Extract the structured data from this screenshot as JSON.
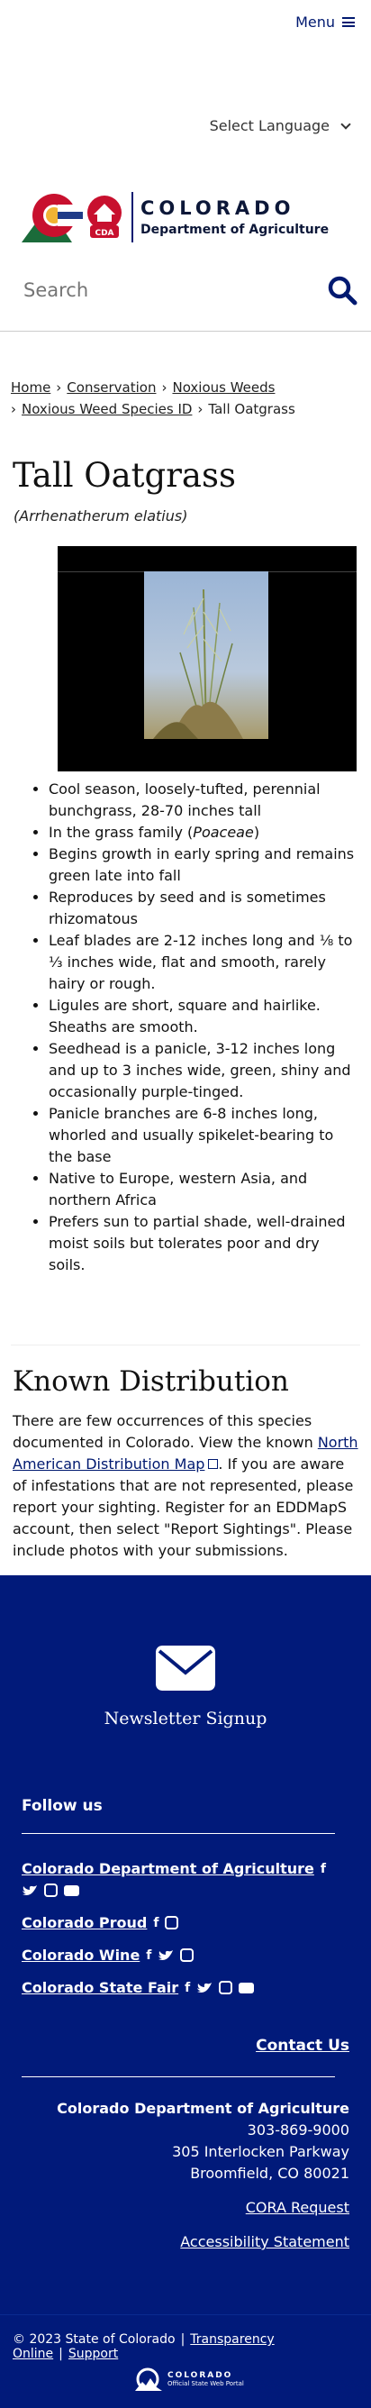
{
  "header": {
    "menu_label": "Menu",
    "language_label": "Select Language",
    "logo": {
      "cda_badge": "CDA",
      "title": "COLORADO",
      "subtitle": "Department of Agriculture"
    },
    "search_placeholder": "Search"
  },
  "breadcrumb": [
    "Home",
    "Conservation",
    "Noxious Weeds",
    "Noxious Weed Species ID",
    "Tall Oatgrass"
  ],
  "page": {
    "title": "Tall Oatgrass",
    "scientific_name": "(Arrhenatherum elatius)",
    "facts": [
      "Cool season, loosely-tufted, perennial bunchgrass, 28-70 inches tall",
      [
        "In the grass family (",
        "Poaceae",
        ")"
      ],
      "Begins growth in early spring and remains green late into fall",
      "Reproduces by seed and is sometimes rhizomatous",
      "Leaf blades are 2-12 inches long and ⅛ to ⅓ inches wide, flat and smooth, rarely hairy or rough.",
      "Ligules are short, square and hairlike. Sheaths are smooth.",
      "Seedhead is a panicle, 3-12 inches long and up to 3 inches wide, green, shiny and occasionally purple-tinged.",
      "Panicle branches are 6-8 inches long, whorled and usually spikelet-bearing to the base",
      "Native to Europe, western Asia, and northern Africa",
      "Prefers sun to partial shade, well-drained moist soils but tolerates poor and dry soils."
    ],
    "distribution": {
      "heading": "Known Distribution",
      "text_1": "There are few occurrences of this species documented in Colorado. View the known ",
      "link": "North American Distribution Map",
      "text_2": ". If you are aware of infestations that are not represented, please report your sighting. Register for an EDDMapS account, then select \"Report Sightings\". Please include photos with your submissions."
    }
  },
  "footer": {
    "newsletter_label": "Newsletter Signup",
    "follow_heading": "Follow us",
    "social": [
      {
        "name": "Colorado Department of Agriculture",
        "icons": [
          "facebook-icon",
          "twitter-icon",
          "instagram-icon",
          "youtube-icon"
        ]
      },
      {
        "name": "Colorado Proud",
        "icons": [
          "facebook-icon",
          "instagram-icon"
        ]
      },
      {
        "name": "Colorado Wine",
        "icons": [
          "facebook-icon",
          "twitter-icon",
          "instagram-icon"
        ]
      },
      {
        "name": "Colorado State Fair",
        "icons": [
          "facebook-icon",
          "twitter-icon",
          "instagram-icon",
          "youtube-icon"
        ]
      }
    ],
    "contact_label": "Contact Us",
    "address": {
      "name": "Colorado Department of Agriculture",
      "phone": "303-869-9000",
      "street": "305 Interlocken Parkway",
      "city": "Broomfield, CO 80021"
    },
    "cora_link": "CORA Request",
    "accessibility_link": "Accessibility Statement",
    "copyright": "© 2023 State of Colorado",
    "transparency_link": "Transparency Online",
    "support_link": "Support",
    "state_logo": {
      "title": "COLORADO",
      "subtitle": "Official State Web Portal"
    },
    "colors": {
      "background": "#011a7a",
      "text": "#ffffff"
    }
  }
}
